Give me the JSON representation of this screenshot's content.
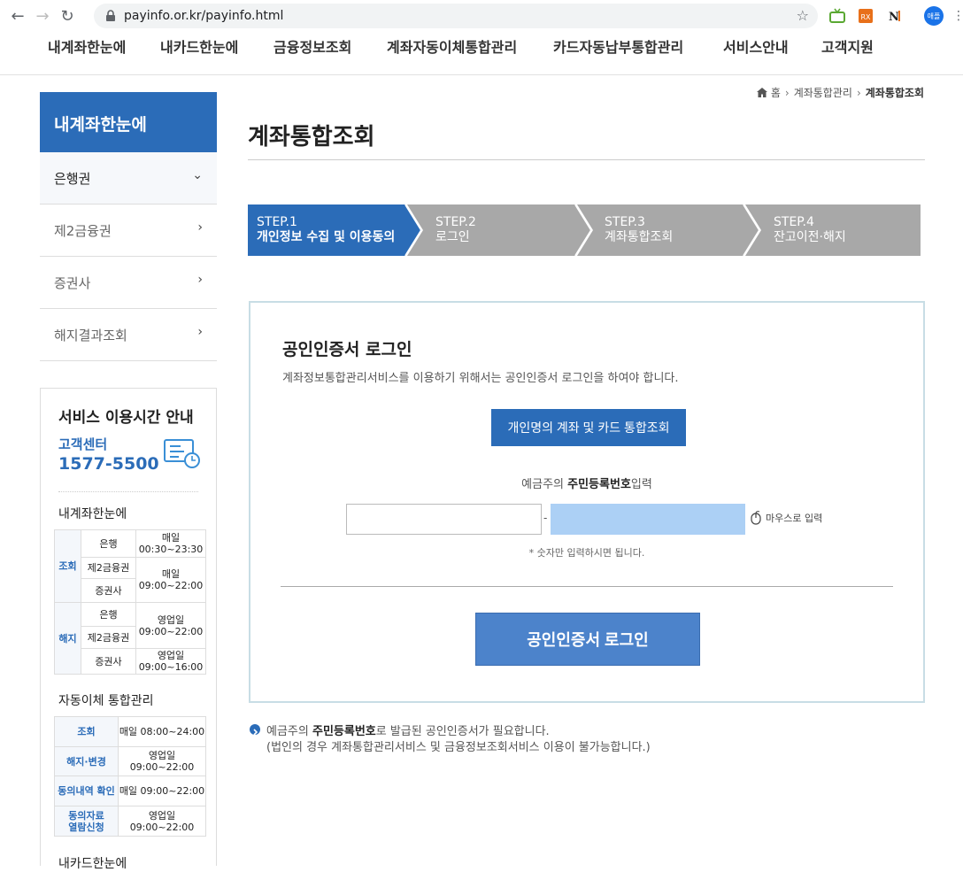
{
  "browser": {
    "url": "payinfo.or.kr/payinfo.html",
    "avatar_label": "애플"
  },
  "topnav": {
    "items": [
      "내계좌한눈에",
      "내카드한눈에",
      "금융정보조회",
      "계좌자동이체통합관리",
      "카드자동납부통합관리",
      "서비스안내",
      "고객지원"
    ]
  },
  "sidebar": {
    "title": "내계좌한눈에",
    "items": [
      {
        "label": "은행권"
      },
      {
        "label": "제2금융권"
      },
      {
        "label": "증권사"
      },
      {
        "label": "해지결과조회"
      }
    ],
    "service": {
      "title": "서비스 이용시간 안내",
      "cc_label": "고객센터",
      "cc_number": "1577-5500",
      "section1": "내계좌한눈에",
      "section2": "자동이체 통합관리",
      "section3_partial": "내카드한눈에",
      "table1": {
        "group_inquiry": "조회",
        "group_cancel": "해지",
        "bank": "은행",
        "second": "제2금융권",
        "securities": "증권사",
        "daily": "매일",
        "inq_bank_time": "00:30~23:30",
        "inq_other_time": "09:00~22:00",
        "business_day": "영업일",
        "cancel_time1": "09:00~22:00",
        "cancel_time2": "09:00~16:00"
      },
      "table2": {
        "r1_label": "조회",
        "r1_time": "매일 08:00~24:00",
        "r2_label": "해지·변경",
        "r2_time": "영업일 09:00~22:00",
        "r3_label": "동의내역 확인",
        "r3_time": "매일 09:00~22:00",
        "r4_label_a": "동의자료",
        "r4_label_b": "열람신청",
        "r4_time": "영업일 09:00~22:00"
      }
    }
  },
  "breadcrumb": {
    "home": "홈",
    "level1": "계좌통합관리",
    "current": "계좌통합조회"
  },
  "page_title": "계좌통합조회",
  "steps": [
    {
      "num": "STEP.1",
      "label": "개인정보 수집 및 이용동의",
      "active": true
    },
    {
      "num": "STEP.2",
      "label": "로그인",
      "active": false
    },
    {
      "num": "STEP.3",
      "label": "계좌통합조회",
      "active": false
    },
    {
      "num": "STEP.4",
      "label": "잔고이전·해지",
      "active": false
    }
  ],
  "colors": {
    "primary": "#2b6cb8",
    "step_inactive": "#a8a8a8",
    "rrn_back_bg": "#acd0f5",
    "cert_button": "#4c83cb"
  },
  "login": {
    "title": "공인인증서 로그인",
    "description": "계좌정보통합관리서비스를 이용하기 위해서는 공인인증서 로그인을 하여야 합니다.",
    "integrated_button": "개인명의 계좌 및 카드 통합조회",
    "rrn_prefix": "예금주의",
    "rrn_bold": "주민등록번호",
    "rrn_suffix": "입력",
    "dash": "-",
    "mouse_input": "마우스로 입력",
    "note": "* 숫자만 입력하시면 됩니다.",
    "cert_button": "공인인증서 로그인"
  },
  "notice": {
    "line1_prefix": "예금주의",
    "line1_bold": "주민등록번호",
    "line1_suffix": "로 발급된 공인인증서가 필요합니다.",
    "line2": "(법인의 경우 계좌통합관리서비스 및 금융정보조회서비스 이용이 불가능합니다.)"
  }
}
